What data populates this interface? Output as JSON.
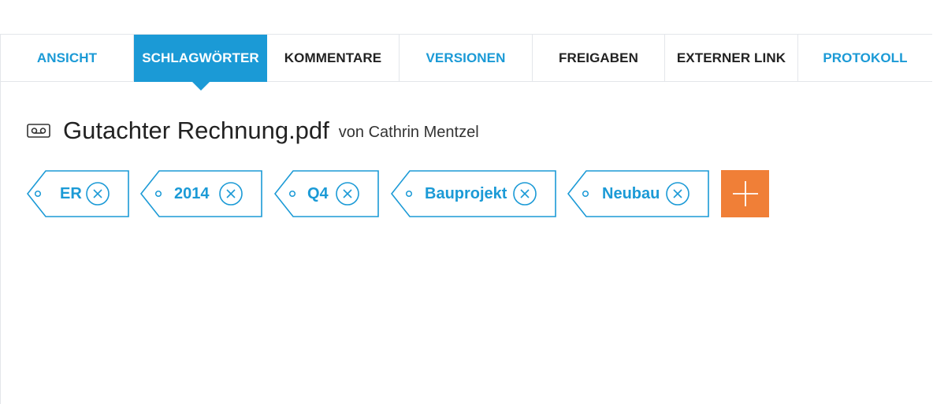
{
  "tabs": [
    {
      "label": "ANSICHT",
      "state": "link"
    },
    {
      "label": "SCHLAGWÖRTER",
      "state": "active"
    },
    {
      "label": "KOMMENTARE",
      "state": "plain"
    },
    {
      "label": "VERSIONEN",
      "state": "link"
    },
    {
      "label": "FREIGABEN",
      "state": "plain"
    },
    {
      "label": "EXTERNER LINK",
      "state": "plain"
    },
    {
      "label": "PROTOKOLL",
      "state": "link"
    }
  ],
  "document": {
    "icon": "tape-icon",
    "title": "Gutachter Rechnung.pdf",
    "author": "von Cathrin Mentzel"
  },
  "tags": [
    {
      "label": "ER"
    },
    {
      "label": "2014"
    },
    {
      "label": "Q4"
    },
    {
      "label": "Bauprojekt"
    },
    {
      "label": "Neubau"
    }
  ],
  "add_button": {
    "icon": "plus-icon"
  },
  "colors": {
    "accent": "#1b9ad6",
    "add": "#f07f37",
    "text": "#222222",
    "border": "#e3e6ea"
  }
}
